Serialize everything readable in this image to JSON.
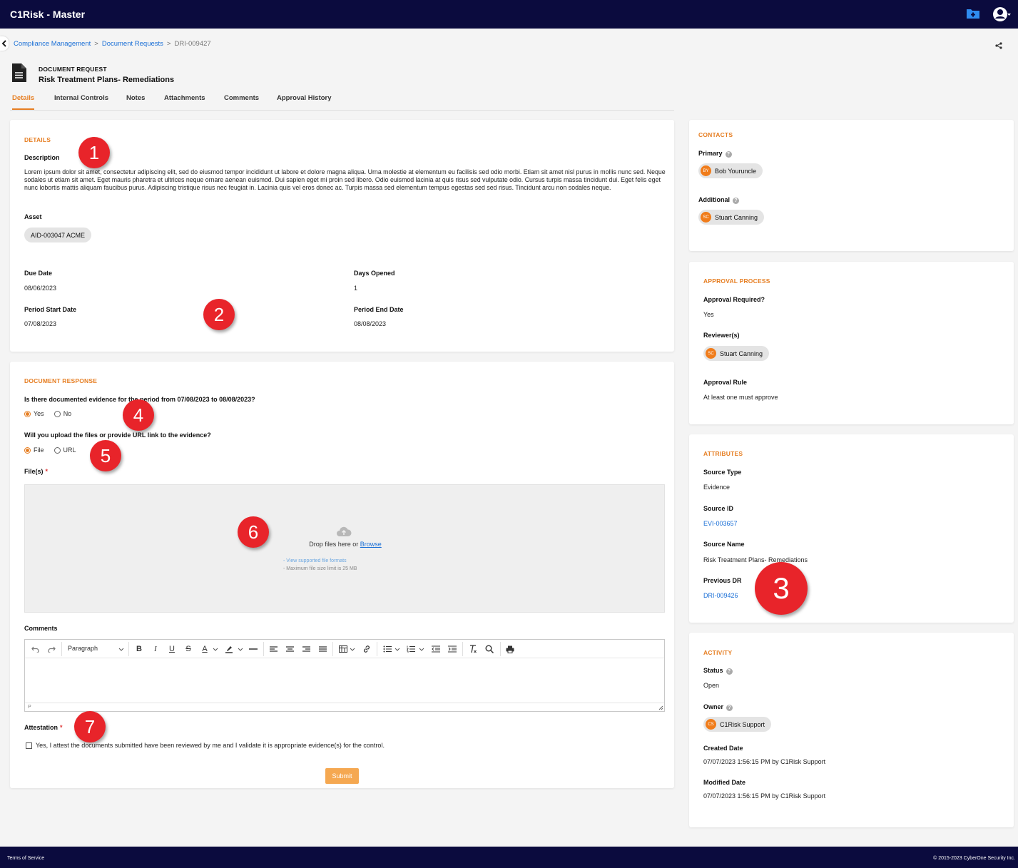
{
  "app": {
    "title": "C1Risk - Master"
  },
  "breadcrumb": {
    "items": [
      "Compliance Management",
      "Document Requests"
    ],
    "current": "DRI-009427"
  },
  "record": {
    "type": "DOCUMENT REQUEST",
    "title": "Risk Treatment Plans- Remediations"
  },
  "tabs": [
    "Details",
    "Internal Controls",
    "Notes",
    "Attachments",
    "Comments",
    "Approval History"
  ],
  "details": {
    "section_title": "DETAILS",
    "description_label": "Description",
    "description": "Lorem ipsum dolor sit amet, consectetur adipiscing elit, sed do eiusmod tempor incididunt ut labore et dolore magna aliqua. Urna molestie at elementum eu facilisis sed odio morbi. Etiam sit amet nisl purus in mollis nunc sed. Neque sodales ut etiam sit amet. Eget mauris pharetra et ultrices neque ornare aenean euismod. Dui sapien eget mi proin sed libero. Odio euismod lacinia at quis risus sed vulputate odio. Cursus turpis massa tincidunt dui. Eget felis eget nunc lobortis mattis aliquam faucibus purus. Adipiscing tristique risus nec feugiat in. Lacinia quis vel eros donec ac. Turpis massa sed elementum tempus egestas sed sed risus. Tincidunt arcu non sodales neque.",
    "asset_label": "Asset",
    "asset": "AID-003047 ACME",
    "due_date_label": "Due Date",
    "due_date": "08/06/2023",
    "days_opened_label": "Days Opened",
    "days_opened": "1",
    "period_start_label": "Period Start Date",
    "period_start": "07/08/2023",
    "period_end_label": "Period End Date",
    "period_end": "08/08/2023"
  },
  "response": {
    "section_title": "DOCUMENT RESPONSE",
    "q1": "Is there documented evidence for the period from 07/08/2023 to 08/08/2023?",
    "q1_options": [
      "Yes",
      "No"
    ],
    "q1_selected": "Yes",
    "q2": "Will you upload the files or provide URL link to the evidence?",
    "q2_options": [
      "File",
      "URL"
    ],
    "q2_selected": "File",
    "files_label": "File(s)",
    "required_mark": "*",
    "dropzone_text": "Drop files here or",
    "dropzone_browse": "Browse",
    "dropzone_hint1": "- View supported file formats",
    "dropzone_hint2": "- Maximum file size limit is 25 MB",
    "comments_label": "Comments",
    "editor_paragraph": "Paragraph",
    "editor_status": "P",
    "attestation_label": "Attestation",
    "attestation_text": "Yes, I attest the documents submitted have been reviewed by me and I validate it is appropriate evidence(s) for the control.",
    "submit_label": "Submit"
  },
  "contacts": {
    "section_title": "CONTACTS",
    "primary_label": "Primary",
    "primary": {
      "initials": "BY",
      "name": "Bob Youruncle"
    },
    "additional_label": "Additional",
    "additional": {
      "initials": "SC",
      "name": "Stuart Canning"
    }
  },
  "approval": {
    "section_title": "APPROVAL PROCESS",
    "required_label": "Approval Required?",
    "required": "Yes",
    "reviewers_label": "Reviewer(s)",
    "reviewer": {
      "initials": "SC",
      "name": "Stuart Canning"
    },
    "rule_label": "Approval Rule",
    "rule": "At least one must approve"
  },
  "attributes": {
    "section_title": "ATTRIBUTES",
    "source_type_label": "Source Type",
    "source_type": "Evidence",
    "source_id_label": "Source ID",
    "source_id": "EVI-003657",
    "source_name_label": "Source Name",
    "source_name": "Risk Treatment Plans- Remediations",
    "previous_dr_label": "Previous DR",
    "previous_dr": "DRI-009426"
  },
  "activity": {
    "section_title": "ACTIVITY",
    "status_label": "Status",
    "status": "Open",
    "owner_label": "Owner",
    "owner": {
      "initials": "CS",
      "name": "C1Risk Support"
    },
    "created_label": "Created Date",
    "created": "07/07/2023 1:56:15 PM by C1Risk Support",
    "modified_label": "Modified Date",
    "modified": "07/07/2023 1:56:15 PM by C1Risk Support"
  },
  "help_glyph": "?",
  "markers": [
    "1",
    "2",
    "3",
    "4",
    "5",
    "6",
    "7"
  ],
  "footer": {
    "terms": "Terms of Service",
    "copyright": "© 2015-2023 CyberOne Security Inc."
  },
  "colors": {
    "nav": "#0b0b3e",
    "accent": "#e67e22",
    "link": "#1a6fd6",
    "marker": "#e8242a",
    "avatar": "#f07c1a"
  }
}
